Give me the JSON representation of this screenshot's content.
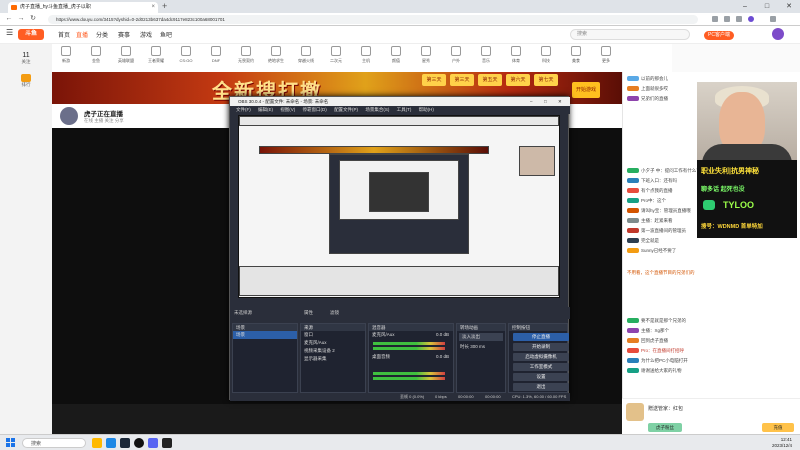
{
  "browser": {
    "tab_title": "虎子直播_hy斗鱼直播_虎子以职",
    "url": "https://www.douyu.com/3415?dyshid=0-2d0213b637da4dc9117e823c100a68001701",
    "new_tab_label": "+",
    "tab_close": "×"
  },
  "site": {
    "logo": "斗鱼",
    "nav": [
      "首页",
      "直播",
      "分类",
      "赛事",
      "游戏",
      "鱼吧"
    ],
    "search_placeholder": "搜索",
    "pc_label": "PC客户端",
    "side": [
      {
        "label": "关注",
        "value": "11"
      },
      {
        "label": "排行",
        "value": ""
      },
      {
        "label": "推荐",
        "value": ""
      }
    ],
    "categories": [
      "新游",
      "金鱼",
      "英雄联盟",
      "王者荣耀",
      "CS:GO",
      "DNF",
      "无畏契约",
      "绝地求生",
      "穿越火线",
      "二次元",
      "主机",
      "颜值",
      "星秀",
      "户外",
      "音乐",
      "体育",
      "科技",
      "美食",
      "更多"
    ],
    "banner_text": "全新搜打撤",
    "banner_days": [
      "第三天",
      "第三天",
      "第五天",
      "第六天",
      "第七天"
    ],
    "banner_cta": "开始游戏",
    "streamer_name": "虎子正在直播",
    "stream_meta": "在线 主播 关注 分享",
    "follow_label": "关注"
  },
  "chat": {
    "lines": [
      "以前的那会儿",
      "上面就很多哎",
      "兄弟们的直播",
      "小夕子 中：提问工作有什么？",
      "下班入口：还有吗",
      "有个点我的直播",
      "Pro中：这个",
      "请叫hy宝：管理员直播哦",
      "主播：赶紧来看",
      "第一波直播间的管理员",
      "完全就是",
      "Sunny已经不要了",
      "不用看，这个直播节目的兄弟们的",
      "要不是就是那个兄弟的",
      "主播：Xg那个",
      "回到虎子直播",
      "Pro：在直播间打招呼",
      "为什么把PC小电脑打开",
      "谢谢送给大家的礼物"
    ],
    "promo": [
      "职业失利|抗男神秘",
      "聊多话 起死也没",
      "TYLOO",
      "搜号：WDNMD 首单特加"
    ],
    "gift_user": "赠送管家：红包",
    "gift_btn1": "虎子粉丝",
    "gift_btn2": "充值"
  },
  "obs": {
    "title": "OBS 30.0.4 - 配置文件: 未命名 - 场景: 未命名",
    "menu": [
      "文件(F)",
      "编辑(E)",
      "视图(V)",
      "停靠窗口(D)",
      "配置文件(P)",
      "场景集合(S)",
      "工具(T)",
      "帮助(H)"
    ],
    "source_label": "未选择源",
    "props_label": "属性",
    "filters_label": "滤镜",
    "docks": {
      "scenes": {
        "title": "场景",
        "items": [
          "场景"
        ]
      },
      "sources": {
        "title": "来源",
        "items": [
          "窗口",
          "麦克风/Aux",
          "视频采集设备 2",
          "显示器采集"
        ]
      },
      "mixer": {
        "title": "混音器",
        "items": [
          {
            "name": "麦克风/Aux",
            "db": "0.0 dB"
          },
          {
            "name": "桌面音频",
            "db": "0.0 dB"
          }
        ]
      },
      "transitions": {
        "title": "转场动画",
        "type": "淡入淡出",
        "duration_label": "时长",
        "duration": "300 ms"
      },
      "controls": {
        "title": "控制按钮",
        "buttons": [
          "停止直播",
          "开始录制",
          "启动虚拟摄像机",
          "工作室模式",
          "设置",
          "退出"
        ]
      }
    },
    "status": {
      "dropped": "丢帧 0 (0.0%)",
      "bitrate": "0 kbps",
      "live_time": "00:00:00",
      "rec_time": "00:00:00",
      "cpu": "CPU: 1.3%, 60.00 / 60.00 FPS"
    }
  },
  "taskbar": {
    "search": "搜索",
    "time": "12:41",
    "date": "2023/12/4"
  }
}
